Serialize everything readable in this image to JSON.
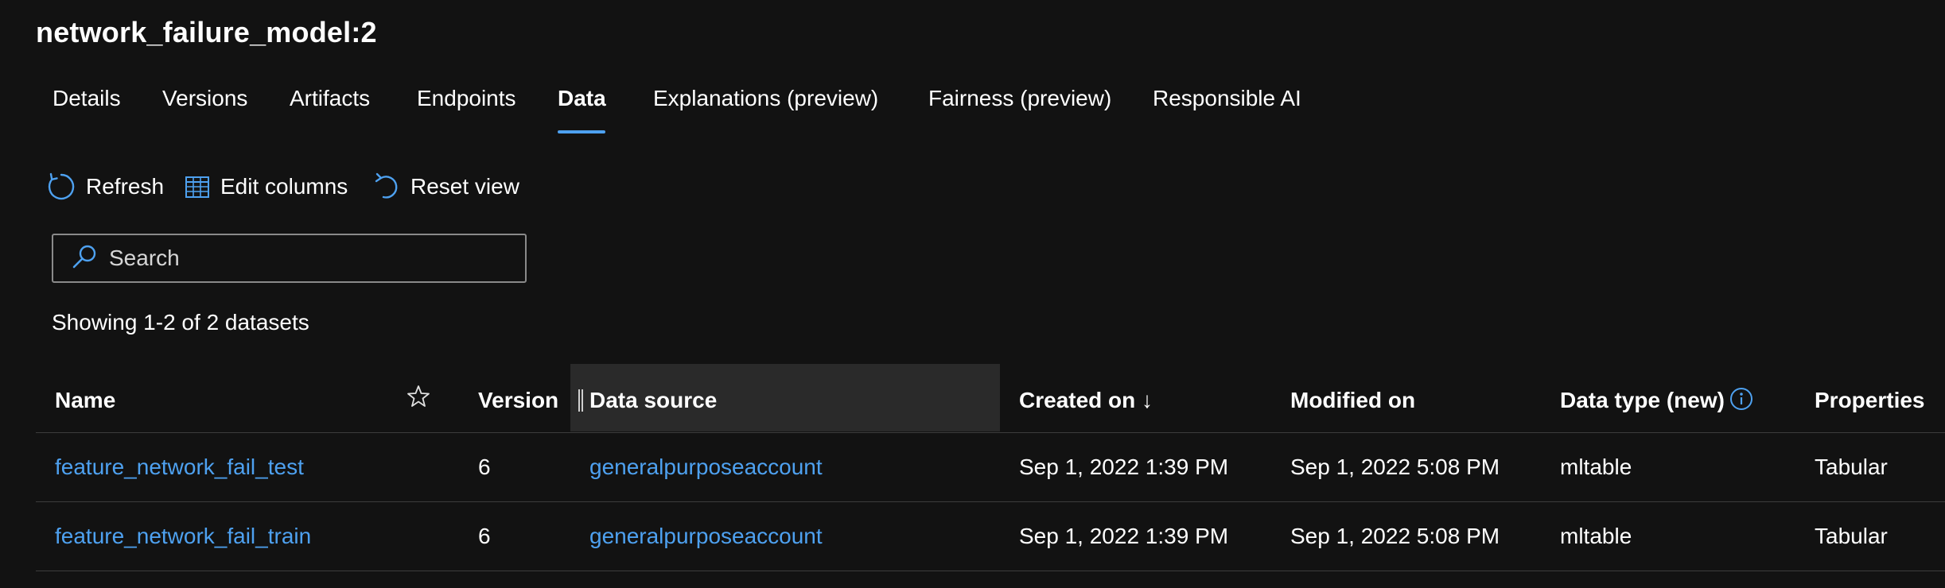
{
  "header": {
    "title": "network_failure_model:2"
  },
  "tabs": [
    {
      "label": "Details"
    },
    {
      "label": "Versions"
    },
    {
      "label": "Artifacts"
    },
    {
      "label": "Endpoints"
    },
    {
      "label": "Data",
      "active": true
    },
    {
      "label": "Explanations (preview)"
    },
    {
      "label": "Fairness (preview)"
    },
    {
      "label": "Responsible AI"
    }
  ],
  "toolbar": {
    "refresh_label": "Refresh",
    "edit_columns_label": "Edit columns",
    "reset_view_label": "Reset view",
    "refresh_icon": "refresh-icon",
    "edit_columns_icon": "table-icon",
    "reset_view_icon": "undo-icon"
  },
  "search": {
    "placeholder": "Search",
    "value": "",
    "icon": "search-icon"
  },
  "showing_text": "Showing 1-2 of 2 datasets",
  "table": {
    "columns": {
      "name": "Name",
      "version": "Version",
      "data_source": "Data source",
      "created_on": "Created on ↓",
      "modified_on": "Modified on",
      "data_type": "Data type (new)",
      "properties": "Properties"
    },
    "rows": [
      {
        "name": "feature_network_fail_test",
        "version": "6",
        "data_source": "generalpurposeaccount",
        "created_on": "Sep 1, 2022 1:39 PM",
        "modified_on": "Sep 1, 2022 5:08 PM",
        "data_type": "mltable",
        "properties": "Tabular"
      },
      {
        "name": "feature_network_fail_train",
        "version": "6",
        "data_source": "generalpurposeaccount",
        "created_on": "Sep 1, 2022 1:39 PM",
        "modified_on": "Sep 1, 2022 5:08 PM",
        "data_type": "mltable",
        "properties": "Tabular"
      }
    ]
  },
  "colors": {
    "background": "#121212",
    "accent": "#4ea1f0",
    "text": "#ffffff"
  }
}
